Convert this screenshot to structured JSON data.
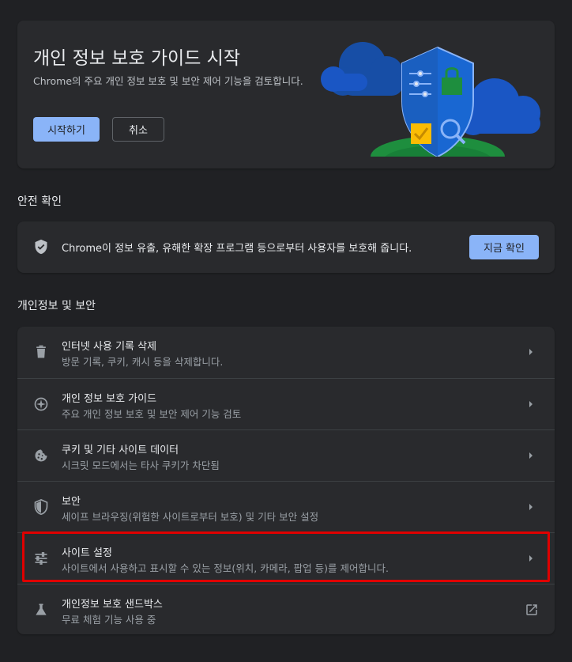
{
  "promo": {
    "title": "개인 정보 보호 가이드 시작",
    "description": "Chrome의 주요 개인 정보 보호 및 보안 제어 기능을 검토합니다.",
    "start_label": "시작하기",
    "cancel_label": "취소"
  },
  "safety_check": {
    "heading": "안전 확인",
    "text": "Chrome이 정보 유출, 유해한 확장 프로그램 등으로부터 사용자를 보호해 줍니다.",
    "button_label": "지금 확인"
  },
  "privacy": {
    "heading": "개인정보 및 보안",
    "items": [
      {
        "title": "인터넷 사용 기록 삭제",
        "subtitle": "방문 기록, 쿠키, 캐시 등을 삭제합니다.",
        "icon": "trash-icon"
      },
      {
        "title": "개인 정보 보호 가이드",
        "subtitle": "주요 개인 정보 보호 및 보안 제어 기능 검토",
        "icon": "compass-icon"
      },
      {
        "title": "쿠키 및 기타 사이트 데이터",
        "subtitle": "시크릿 모드에서는 타사 쿠키가 차단됨",
        "icon": "cookie-icon"
      },
      {
        "title": "보안",
        "subtitle": "세이프 브라우징(위험한 사이트로부터 보호) 및 기타 보안 설정",
        "icon": "shield-icon"
      },
      {
        "title": "사이트 설정",
        "subtitle": "사이트에서 사용하고 표시할 수 있는 정보(위치, 카메라, 팝업 등)를 제어합니다.",
        "icon": "sliders-icon"
      },
      {
        "title": "개인정보 보호 샌드박스",
        "subtitle": "무료 체험 기능 사용 중",
        "icon": "flask-icon"
      }
    ]
  },
  "colors": {
    "background": "#202124",
    "card": "#292a2d",
    "accent": "#8ab4f8",
    "highlight": "#e00000"
  }
}
